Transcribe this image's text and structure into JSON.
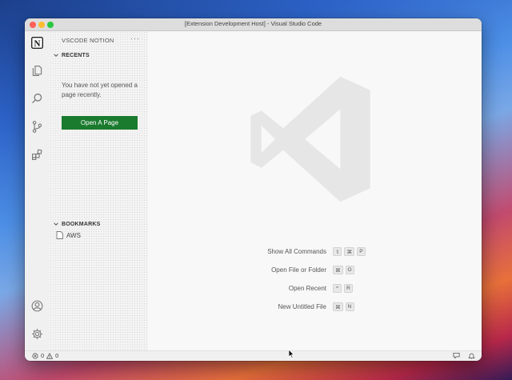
{
  "window": {
    "title": "[Extension Development Host] - Visual Studio Code"
  },
  "activity_bar": {
    "items": [
      {
        "name": "notion-logo-icon",
        "label": "N"
      },
      {
        "name": "explorer-icon"
      },
      {
        "name": "search-icon"
      },
      {
        "name": "source-control-icon"
      },
      {
        "name": "extensions-icon"
      },
      {
        "name": "account-icon"
      },
      {
        "name": "gear-icon"
      }
    ]
  },
  "sidebar": {
    "title": "VSCODE NOTION",
    "more": "···",
    "recents": {
      "heading": "RECENTS",
      "message": "You have not yet opened a page recently.",
      "button_label": "Open A Page"
    },
    "bookmarks": {
      "heading": "BOOKMARKS",
      "items": [
        {
          "label": "AWS"
        }
      ]
    }
  },
  "editor": {
    "shortcuts": [
      {
        "label": "Show All Commands",
        "keys": [
          "⇧",
          "⌘",
          "P"
        ]
      },
      {
        "label": "Open File or Folder",
        "keys": [
          "⌘",
          "O"
        ]
      },
      {
        "label": "Open Recent",
        "keys": [
          "^",
          "R"
        ]
      },
      {
        "label": "New Untitled File",
        "keys": [
          "⌘",
          "N"
        ]
      }
    ]
  },
  "status_bar": {
    "errors": "0",
    "warnings": "0"
  },
  "colors": {
    "button_green": "#1a7a2e",
    "close": "#fe5f57",
    "minimize": "#febc2e",
    "maximize": "#28c840"
  }
}
